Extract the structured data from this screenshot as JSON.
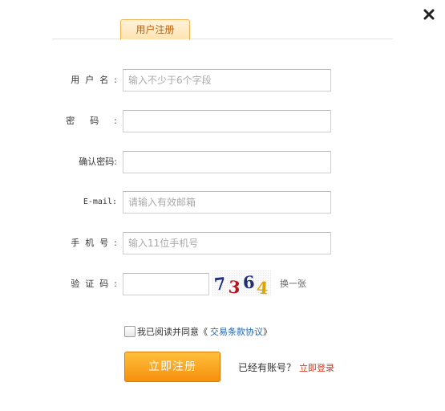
{
  "dialog": {
    "tab_label": "用户注册",
    "close_icon": "close-icon"
  },
  "form": {
    "username": {
      "label": "用户名",
      "placeholder": "输入不少于6个字段",
      "value": ""
    },
    "password": {
      "label": "密码",
      "value": ""
    },
    "confirm_password": {
      "label": "确认密码",
      "value": ""
    },
    "email": {
      "label": "E-mail",
      "placeholder": "请输入有效邮箱",
      "value": ""
    },
    "phone": {
      "label": "手机号",
      "placeholder": "输入11位手机号",
      "value": ""
    },
    "captcha": {
      "label": "验证码",
      "value": "",
      "digits": [
        "7",
        "3",
        "6",
        "4"
      ],
      "digit_colors": [
        "#1f2f7a",
        "#b8141d",
        "#1f2f7a",
        "#e0a400"
      ],
      "refresh_label": "换一张"
    },
    "colon": ":",
    "agreement": {
      "checked": false,
      "text": "我已阅读并同意《",
      "link_label": "交易条款协议",
      "close_bracket": "》"
    },
    "submit_label": "立即注册",
    "have_account_text": "已经有账号？",
    "login_link_label": "立即登录"
  },
  "colors": {
    "accent_orange": "#f58f0c",
    "tab_text": "#c85e00",
    "link_blue": "#2a66b0",
    "login_red": "#d9381e"
  }
}
